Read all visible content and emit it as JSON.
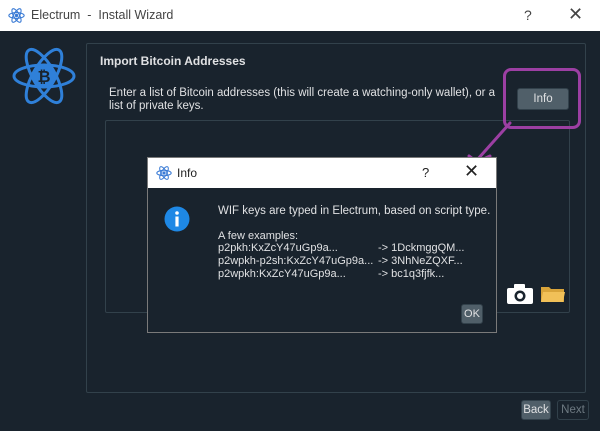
{
  "window": {
    "app_name": "Electrum",
    "title": "Electrum  -  Install Wizard",
    "help_glyph": "?",
    "close_glyph": "✕"
  },
  "page": {
    "heading": "Import Bitcoin Addresses",
    "description": "Enter a list of Bitcoin addresses (this will create a watching-only wallet), or a list of private keys.",
    "info_button": "Info",
    "input_value": "",
    "camera_icon": "camera-icon",
    "folder_icon": "folder-icon"
  },
  "footer": {
    "back_label": "Back",
    "next_label": "Next"
  },
  "dialog": {
    "title": "Info",
    "help_glyph": "?",
    "close_glyph": "✕",
    "message": "WIF keys are typed in Electrum, based on script type.",
    "examples_title": "A few examples:",
    "examples": [
      {
        "key": "p2pkh:KxZcY47uGp9a...",
        "arrow": "-> 1DckmggQM..."
      },
      {
        "key": "p2wpkh-p2sh:KxZcY47uGp9a...",
        "arrow": "-> 3NhNeZQXF..."
      },
      {
        "key": "p2wpkh:KxZcY47uGp9a...",
        "arrow": "-> bc1q3fjfk..."
      }
    ],
    "ok_label": "OK"
  },
  "annotation": {
    "highlight_color": "#9c3fa3"
  },
  "colors": {
    "background": "#19232d",
    "border": "#32414b",
    "button": "#505f69",
    "text": "#e0e1e3",
    "info_blue": "#1e88e5"
  }
}
